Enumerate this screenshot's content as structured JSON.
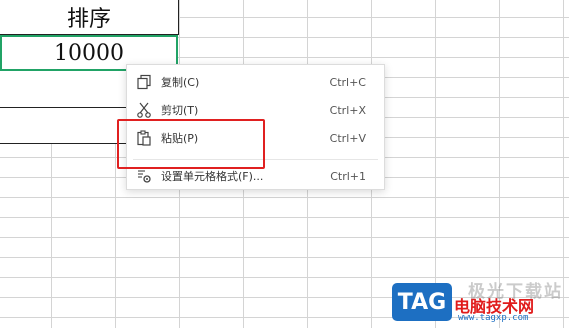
{
  "sheet": {
    "header": "排序",
    "value": "10000"
  },
  "context_menu": {
    "items": [
      {
        "label": "复制(C)",
        "shortcut": "Ctrl+C",
        "icon": "copy-icon"
      },
      {
        "label": "剪切(T)",
        "shortcut": "Ctrl+X",
        "icon": "cut-icon"
      },
      {
        "label": "粘贴(P)",
        "shortcut": "Ctrl+V",
        "icon": "paste-icon"
      },
      {
        "label": "设置单元格格式(F)...",
        "shortcut": "Ctrl+1",
        "icon": "format-cells-icon"
      }
    ]
  },
  "watermark": {
    "top_text": "极光下载站",
    "tag": "TAG",
    "site": "电脑技术网",
    "url": "www.tagxp.com"
  },
  "colors": {
    "selection_border": "#21a366",
    "highlight": "#e02020",
    "tag_blue": "#1d6fc2"
  }
}
